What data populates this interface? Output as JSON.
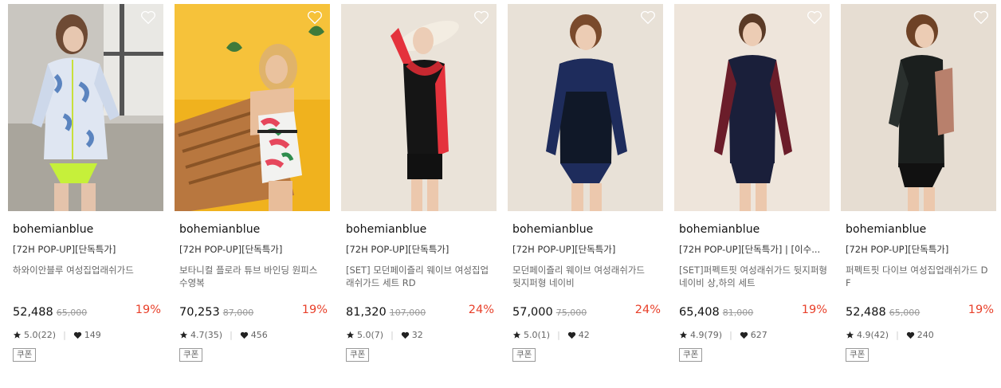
{
  "colors": {
    "discount": "#e8402a",
    "heart_outline": "#ffffff",
    "star": "#222222"
  },
  "products": [
    {
      "brand": "bohemianblue",
      "tag": "[72H POP-UP][단독특가]",
      "name": "하와이안블루 여성집업래쉬가드",
      "price": "52,488",
      "original_price": "65,000",
      "discount": "19%",
      "rating": "5.0(22)",
      "likes": "149",
      "badge": "쿠폰"
    },
    {
      "brand": "bohemianblue",
      "tag": "[72H POP-UP][단독특가]",
      "name": "보타니컬 플로라 튜브 바인딩 원피스 수영복",
      "price": "70,253",
      "original_price": "87,000",
      "discount": "19%",
      "rating": "4.7(35)",
      "likes": "456",
      "badge": "쿠폰"
    },
    {
      "brand": "bohemianblue",
      "tag": "[72H POP-UP][단독특가]",
      "name": "[SET] 모던페이즐리 웨이브 여성집업 래쉬가드 세트 RD",
      "price": "81,320",
      "original_price": "107,000",
      "discount": "24%",
      "rating": "5.0(7)",
      "likes": "32",
      "badge": "쿠폰"
    },
    {
      "brand": "bohemianblue",
      "tag": "[72H POP-UP][단독특가]",
      "name": "모던페이즐리 웨이브 여성래쉬가드 뒷지퍼형 네이비",
      "price": "57,000",
      "original_price": "75,000",
      "discount": "24%",
      "rating": "5.0(1)",
      "likes": "42",
      "badge": "쿠폰"
    },
    {
      "brand": "bohemianblue",
      "tag": "[72H POP-UP][단독특가] | [이수...",
      "name": "[SET]퍼펙트핏 여성래쉬가드 뒷지퍼형 네이비 상,하의 세트",
      "price": "65,408",
      "original_price": "81,000",
      "discount": "19%",
      "rating": "4.9(79)",
      "likes": "627",
      "badge": "쿠폰"
    },
    {
      "brand": "bohemianblue",
      "tag": "[72H POP-UP][단독특가]",
      "name": "퍼펙트핏 다이브 여성집업래쉬가드 D F",
      "price": "52,488",
      "original_price": "65,000",
      "discount": "19%",
      "rating": "4.9(42)",
      "likes": "240",
      "badge": "쿠폰"
    }
  ]
}
